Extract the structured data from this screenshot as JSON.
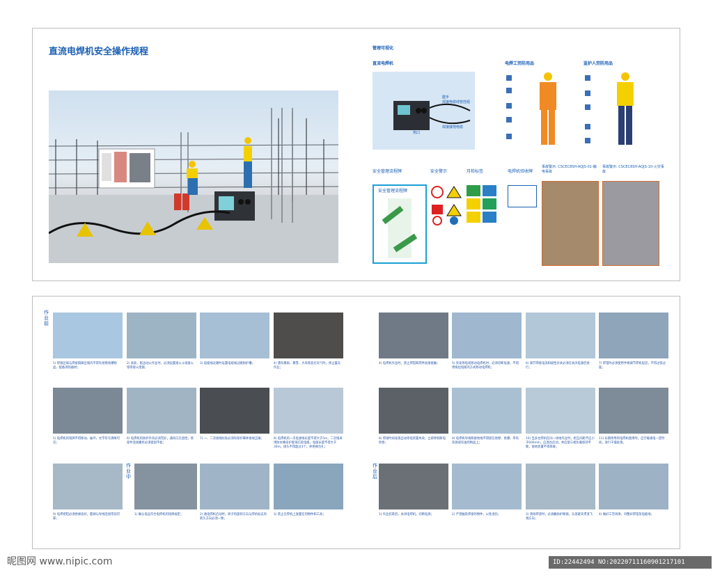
{
  "title": "直流电焊机安全操作规程",
  "management": {
    "heading": "管理可视化",
    "dc_welder_label": "直流电焊机",
    "welder_ppe_label": "电焊工劳防用品",
    "guard_ppe_label": "监护人劳防用品",
    "flow_label": "安全管理流程牌",
    "warning_label": "安全警示",
    "inspection_label": "月检标签",
    "acceptance_label": "电焊机验收牌",
    "case1_label": "事故警示: CSCEC8SH-AQJS-01-触电事故",
    "case2_label": "事故警示: CSCEC8SH-AQJS-10-火灾事故",
    "flow_board_title": "安全管理流程牌",
    "welder_parts": [
      "握手",
      "焊接电缆线管控组",
      "热口",
      "焊接接地电缆"
    ]
  },
  "stages": {
    "before": "作业前",
    "during": "作业中",
    "after": "作业后"
  },
  "steps": [
    "1) 焊接区域与焊接隔离区域内不得有易燃易爆物品，配备消防器材；",
    "2) 高处、临边动火作业时，必须设置接火斗或接火毯等接火措施；",
    "3) 电缆线过路时设置电缆线过路防护槽；",
    "4) 遇有暴雨、暴雪、大风等恶劣天气时，停止露天作业；",
    "5) 电焊机的铭牌不得移动、破坏，文字符号清晰可见；",
    "6) 电焊机的防护外壳必须完好，通风口无遮挡，各部件连接螺栓必须紧固不松；",
    "7) 一、二次接线柱处必须有保护罩并接线正确；",
    "8) 电焊机的一次电源线长度不得大于5m，二次线采用防水橡皮护套铜芯软电缆，电缆长度不得大于30m，接头不得超过3个，并绝缘包扎；",
    "9) 电焊把钳必须绝缘良好，握柄与导线连接牢固可靠；",
    "1) 确认电压符合电焊机的铭牌规定；",
    "2) 通电焊机启动时，转子的旋转方向与焊机标志的箭头方向必须一致；",
    "3) 禁止在焊机上放置任何物件和工具；",
    "4) 电焊机作业时，禁止焊钳和焊件直接接触；",
    "5) 突发停电或移动电焊机时，必须切断电源，不得用拖拉电缆的方式移动电焊机；",
    "6) 调节焊接电流和极性开关必须在关闭电源后进行；",
    "7) 焊钳时必须使用手柄调节焊机电流，不得过快过猛；",
    "8) 焊接时如发现自动停电装置失效，立即停机断电检修；",
    "9) 电焊机导线和接地线不得搭在易燃、易爆、带有热源或有油的物品上；",
    "10) 当多台焊机在同一场地作业时，相互间距不应小于600mm，应逐台启动，并应使三相负载保持平衡，接地装置不得串联；",
    "11) 长期停用的电焊机使用时，应空载通电一定时间，进行干燥处理。",
    "1) 作业结束后，关闭电焊机，切断电源；",
    "2) 严禁触及焊接的物件，以免烫伤；",
    "3) 清除焊渣时，必须戴防护眼镜，头部避开焊渣飞溅方向；",
    "4) 做好工完场清，归整好焊钳及电缆线；"
  ],
  "footer": {
    "logo": "昵图网 www.nipic.com",
    "id": "ID:22442494 NO:20220711160901217101"
  }
}
